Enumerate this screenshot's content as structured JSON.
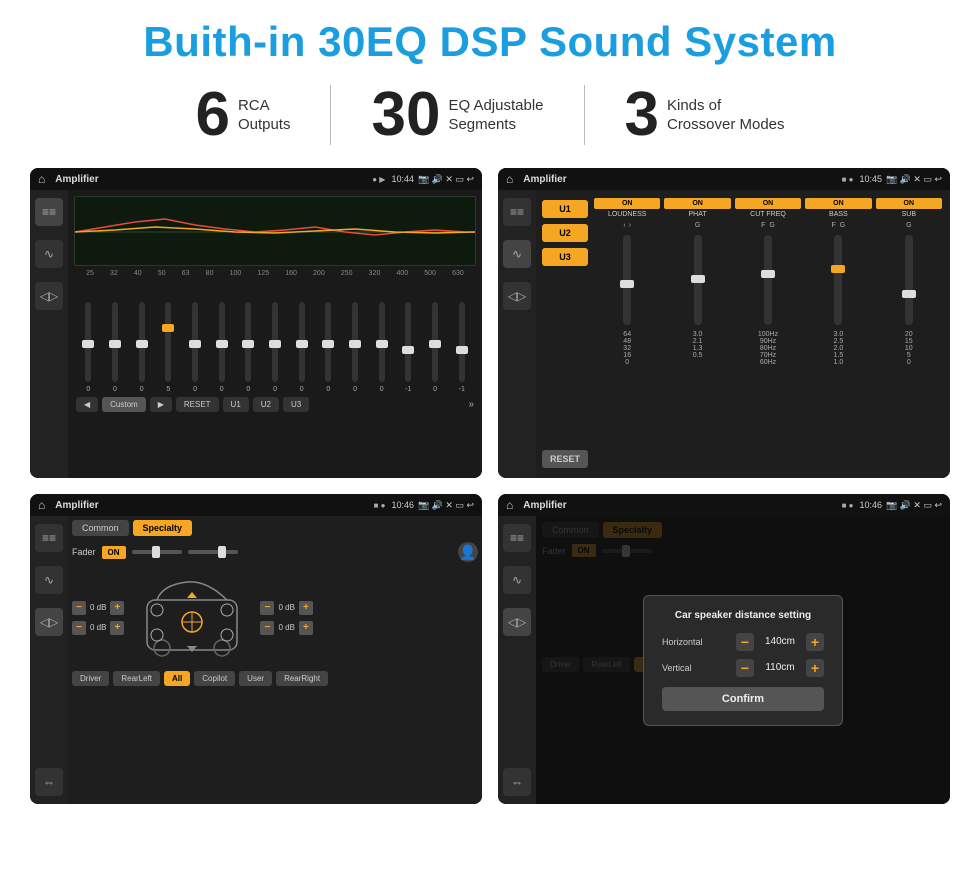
{
  "header": {
    "title": "Buith-in 30EQ DSP Sound System"
  },
  "stats": [
    {
      "number": "6",
      "label": "RCA\nOutputs"
    },
    {
      "number": "30",
      "label": "EQ Adjustable\nSegments"
    },
    {
      "number": "3",
      "label": "Kinds of\nCrossover Modes"
    }
  ],
  "screens": [
    {
      "id": "eq-screen",
      "app_name": "Amplifier",
      "time": "10:44",
      "type": "eq"
    },
    {
      "id": "channels-screen",
      "app_name": "Amplifier",
      "time": "10:45",
      "type": "channels"
    },
    {
      "id": "speaker-screen",
      "app_name": "Amplifier",
      "time": "10:46",
      "type": "speaker"
    },
    {
      "id": "distance-screen",
      "app_name": "Amplifier",
      "time": "10:46",
      "type": "distance"
    }
  ],
  "eq": {
    "freq_labels": [
      "25",
      "32",
      "40",
      "50",
      "63",
      "80",
      "100",
      "125",
      "160",
      "200",
      "250",
      "320",
      "400",
      "500",
      "630"
    ],
    "values": [
      "0",
      "0",
      "0",
      "5",
      "0",
      "0",
      "0",
      "0",
      "0",
      "0",
      "0",
      "0",
      "-1",
      "0",
      "-1"
    ],
    "preset": "Custom",
    "buttons": [
      "RESET",
      "U1",
      "U2",
      "U3"
    ]
  },
  "channels": {
    "presets": [
      "U1",
      "U2",
      "U3"
    ],
    "controls": [
      {
        "name": "LOUDNESS",
        "state": "ON"
      },
      {
        "name": "PHAT",
        "state": "ON"
      },
      {
        "name": "CUT FREQ",
        "state": "ON"
      },
      {
        "name": "BASS",
        "state": "ON"
      },
      {
        "name": "SUB",
        "state": "ON"
      }
    ]
  },
  "speaker": {
    "tabs": [
      "Common",
      "Specialty"
    ],
    "fader_label": "Fader",
    "fader_state": "ON",
    "db_values": [
      "0 dB",
      "0 dB",
      "0 dB",
      "0 dB"
    ],
    "bottom_btns": [
      "Driver",
      "RearLeft",
      "All",
      "Copilot",
      "User",
      "RearRight"
    ]
  },
  "distance_dialog": {
    "title": "Car speaker distance setting",
    "horizontal_label": "Horizontal",
    "horizontal_value": "140cm",
    "vertical_label": "Vertical",
    "vertical_value": "110cm",
    "confirm_label": "Confirm"
  }
}
